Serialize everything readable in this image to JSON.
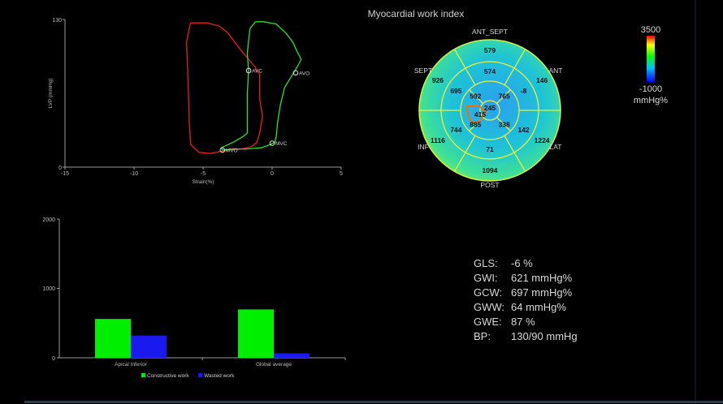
{
  "chart_data": [
    {
      "type": "line",
      "title": "",
      "xlabel": "Strain(%)",
      "ylabel": "LVP (mmHg)",
      "xlim": [
        -15,
        5
      ],
      "ylim": [
        0,
        130
      ],
      "xticks": [
        "-15",
        "-10",
        "-5",
        "0",
        "5"
      ],
      "yticks": [
        "0",
        "130"
      ],
      "series": [
        {
          "color": "#e62020",
          "points": [
            [
              -5.9,
              127
            ],
            [
              -4.7,
              127
            ],
            [
              -3.8,
              124
            ],
            [
              -3.2,
              118
            ],
            [
              -2.7,
              110
            ],
            [
              -2.2,
              102
            ],
            [
              -1.7,
              95
            ],
            [
              -1.3,
              89
            ],
            [
              -0.9,
              82
            ],
            [
              -0.9,
              60
            ],
            [
              -0.7,
              45
            ],
            [
              -0.9,
              30
            ],
            [
              -1.1,
              22
            ],
            [
              -1.5,
              18
            ],
            [
              -2.2,
              16
            ],
            [
              -3.2,
              15
            ],
            [
              -4.5,
              12
            ],
            [
              -5.3,
              13
            ],
            [
              -5.9,
              20
            ],
            [
              -6.0,
              40
            ],
            [
              -6.1,
              80
            ],
            [
              -6.2,
              110
            ],
            [
              -6.0,
              122
            ],
            [
              -5.9,
              127
            ]
          ]
        },
        {
          "color": "#2ee02e",
          "points": [
            [
              -1.2,
              128
            ],
            [
              -0.6,
              128
            ],
            [
              0.3,
              126
            ],
            [
              1.0,
              118
            ],
            [
              1.5,
              110
            ],
            [
              1.8,
              102
            ],
            [
              2.1,
              95
            ],
            [
              1.9,
              90
            ],
            [
              1.6,
              84
            ],
            [
              1.3,
              78
            ],
            [
              0.9,
              70
            ],
            [
              0.6,
              55
            ],
            [
              0.4,
              40
            ],
            [
              0.3,
              27
            ],
            [
              0.2,
              22
            ],
            [
              -0.1,
              20
            ],
            [
              -0.8,
              17
            ],
            [
              -1.8,
              16
            ],
            [
              -2.8,
              16
            ],
            [
              -3.6,
              15
            ],
            [
              -3.7,
              17
            ],
            [
              -2.8,
              22
            ],
            [
              -2.1,
              27
            ],
            [
              -1.8,
              30
            ],
            [
              -1.8,
              50
            ],
            [
              -1.8,
              65
            ],
            [
              -1.7,
              85
            ],
            [
              -1.8,
              100
            ],
            [
              -1.7,
              112
            ],
            [
              -1.6,
              122
            ],
            [
              -1.2,
              128
            ]
          ]
        }
      ],
      "markers": [
        {
          "label": "AVC",
          "x": -1.7,
          "y": 85
        },
        {
          "label": "AVO",
          "x": 1.7,
          "y": 83
        },
        {
          "label": "MVC",
          "x": 0.0,
          "y": 21
        },
        {
          "label": "MVO",
          "x": -3.6,
          "y": 15
        }
      ]
    },
    {
      "type": "bar",
      "title": "",
      "categories": [
        "Apical Inferior",
        "Global average"
      ],
      "ylim": [
        0,
        2000
      ],
      "yticks": [
        "0",
        "1000",
        "2000"
      ],
      "series": [
        {
          "name": "Constructive work",
          "color": "#00ee00",
          "values": [
            560,
            697
          ]
        },
        {
          "name": "Wasted work",
          "color": "#1a1aee",
          "values": [
            320,
            64
          ]
        }
      ],
      "legend": "bottom"
    },
    {
      "type": "heatmap",
      "title": "Myocardial work index",
      "walls": [
        "ANT_SEPT",
        "ANT",
        "LAT",
        "POST",
        "INF",
        "SEPT"
      ],
      "segments": {
        "basal": [
          {
            "wall": "ANT_SEPT",
            "value": 579
          },
          {
            "wall": "ANT",
            "value": 146
          },
          {
            "wall": "LAT",
            "value": 1224
          },
          {
            "wall": "POST",
            "value": 1094
          },
          {
            "wall": "INF",
            "value": 1116
          },
          {
            "wall": "SEPT",
            "value": 926
          }
        ],
        "mid": [
          {
            "wall": "ANT_SEPT",
            "value": 574
          },
          {
            "wall": "ANT",
            "value": -8
          },
          {
            "wall": "LAT",
            "value": 142
          },
          {
            "wall": "POST",
            "value": 71
          },
          {
            "wall": "INF",
            "value": 744
          },
          {
            "wall": "SEPT",
            "value": 695
          }
        ],
        "apical": [
          {
            "wall": "ANT",
            "value": 765
          },
          {
            "wall": "LAT",
            "value": 338
          },
          {
            "wall": "POST",
            "value": 885
          },
          {
            "wall": "SEPT",
            "value": 592
          }
        ],
        "apex": [
          {
            "value": 415
          },
          {
            "value": 245
          }
        ]
      },
      "colorbar": {
        "max": "3500",
        "min": "-1000",
        "unit": "mmHg%"
      }
    }
  ],
  "stats": [
    {
      "label": "GLS:",
      "value": "-6 %"
    },
    {
      "label": "GWI:",
      "value": "621 mmHg%"
    },
    {
      "label": "GCW:",
      "value": "697 mmHg%"
    },
    {
      "label": "GWW:",
      "value": "64 mmHg%"
    },
    {
      "label": "GWE:",
      "value": "87 %"
    },
    {
      "label": "BP:",
      "value": "130/90 mmHg"
    }
  ]
}
